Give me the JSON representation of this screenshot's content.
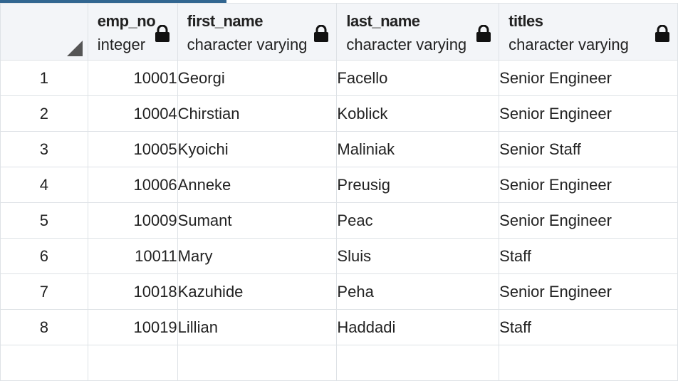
{
  "columns": [
    {
      "name": "emp_no",
      "type": "integer",
      "locked": true
    },
    {
      "name": "first_name",
      "type": "character varying",
      "locked": true
    },
    {
      "name": "last_name",
      "type": "character varying",
      "locked": true
    },
    {
      "name": "titles",
      "type": "character varying",
      "locked": true
    }
  ],
  "rows": [
    {
      "num": "1",
      "emp_no": "10001",
      "first_name": "Georgi",
      "last_name": "Facello",
      "titles": "Senior Engineer"
    },
    {
      "num": "2",
      "emp_no": "10004",
      "first_name": "Chirstian",
      "last_name": "Koblick",
      "titles": "Senior Engineer"
    },
    {
      "num": "3",
      "emp_no": "10005",
      "first_name": "Kyoichi",
      "last_name": "Maliniak",
      "titles": "Senior Staff"
    },
    {
      "num": "4",
      "emp_no": "10006",
      "first_name": "Anneke",
      "last_name": "Preusig",
      "titles": "Senior Engineer"
    },
    {
      "num": "5",
      "emp_no": "10009",
      "first_name": "Sumant",
      "last_name": "Peac",
      "titles": "Senior Engineer"
    },
    {
      "num": "6",
      "emp_no": "10011",
      "first_name": "Mary",
      "last_name": "Sluis",
      "titles": "Staff"
    },
    {
      "num": "7",
      "emp_no": "10018",
      "first_name": "Kazuhide",
      "last_name": "Peha",
      "titles": "Senior Engineer"
    },
    {
      "num": "8",
      "emp_no": "10019",
      "first_name": "Lillian",
      "last_name": "Haddadi",
      "titles": "Staff"
    }
  ],
  "icons": {
    "lock": "lock-icon",
    "corner": "select-all-triangle-icon"
  },
  "colors": {
    "header_bg": "#f3f5f8",
    "border": "#dee2e6",
    "accent": "#326690"
  }
}
